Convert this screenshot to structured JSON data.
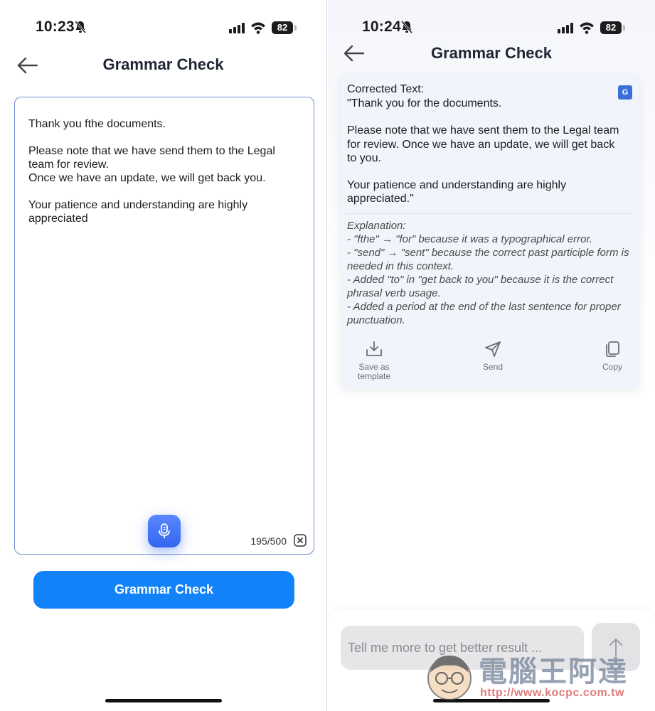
{
  "left": {
    "status": {
      "time": "10:23",
      "battery": "82"
    },
    "title": "Grammar Check",
    "editor": {
      "text": "Thank you fthe documents.\n\nPlease note that we have send them to the Legal team for review.\nOnce we have an update, we will get back you.\n\nYour patience and understanding are highly appreciated",
      "char_count": "195/500"
    },
    "button_label": "Grammar Check"
  },
  "right": {
    "status": {
      "time": "10:24",
      "battery": "82"
    },
    "title": "Grammar Check",
    "result": {
      "corrected_label": "Corrected Text:",
      "corrected_text": "\"Thank you for the documents.\n\nPlease note that we have sent them to the Legal team for review. Once we have an update, we will get back to you.\n\nYour patience and understanding are highly appreciated.\"",
      "explanation": "Explanation:\n- \"fthe\" → \"for\" because it was a typographical error.\n- \"send\" → \"sent\" because the correct past participle form is needed in this context.\n- Added \"to\" in \"get back to you\" because it is the correct phrasal verb usage.\n- Added a period at the end of the last sentence for proper punctuation.",
      "actions": {
        "save_template": "Save as\ntemplate",
        "send": "Send",
        "copy": "Copy"
      }
    },
    "composer": {
      "placeholder": "Tell me more to get better result ..."
    }
  },
  "watermark": {
    "title": "電腦王阿達",
    "url": "http://www.kocpc.com.tw"
  },
  "colors": {
    "accent": "#1282f8",
    "mic": "#3266f0",
    "editor_border": "#6d8fd0"
  },
  "icons": [
    "bell-slash-icon",
    "signal-icon",
    "wifi-icon",
    "battery-icon",
    "back-arrow-icon",
    "microphone-icon",
    "clear-icon",
    "translate-icon",
    "download-icon",
    "send-icon",
    "copy-icon",
    "arrow-up-icon"
  ]
}
